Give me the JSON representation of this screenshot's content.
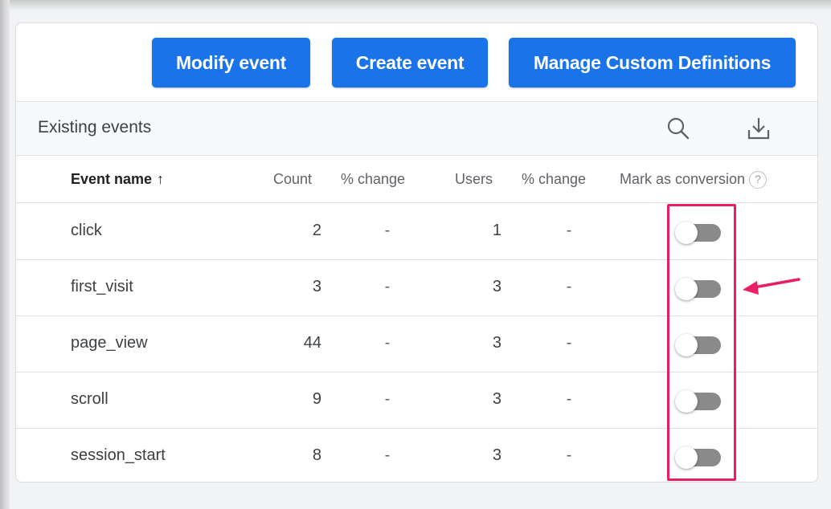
{
  "toolbar": {
    "modify_label": "Modify event",
    "create_label": "Create event",
    "manage_label": "Manage Custom Definitions"
  },
  "section": {
    "title": "Existing events",
    "icons": [
      "search-icon",
      "download-icon"
    ]
  },
  "table": {
    "columns": {
      "name": "Event name",
      "count": "Count",
      "pct_change_1": "% change",
      "users": "Users",
      "pct_change_2": "% change",
      "mark": "Mark as conversion"
    },
    "sort_indicator": "↑",
    "help_glyph": "?",
    "rows": [
      {
        "name": "click",
        "count": "2",
        "pct_change_1": "-",
        "users": "1",
        "pct_change_2": "-",
        "conversion": false
      },
      {
        "name": "first_visit",
        "count": "3",
        "pct_change_1": "-",
        "users": "3",
        "pct_change_2": "-",
        "conversion": false
      },
      {
        "name": "page_view",
        "count": "44",
        "pct_change_1": "-",
        "users": "3",
        "pct_change_2": "-",
        "conversion": false
      },
      {
        "name": "scroll",
        "count": "9",
        "pct_change_1": "-",
        "users": "3",
        "pct_change_2": "-",
        "conversion": false
      },
      {
        "name": "session_start",
        "count": "8",
        "pct_change_1": "-",
        "users": "3",
        "pct_change_2": "-",
        "conversion": false
      }
    ]
  },
  "colors": {
    "primary_button": "#1a73e8",
    "annotation": "#e91e63",
    "toggle_off": "#8a8a8a"
  }
}
